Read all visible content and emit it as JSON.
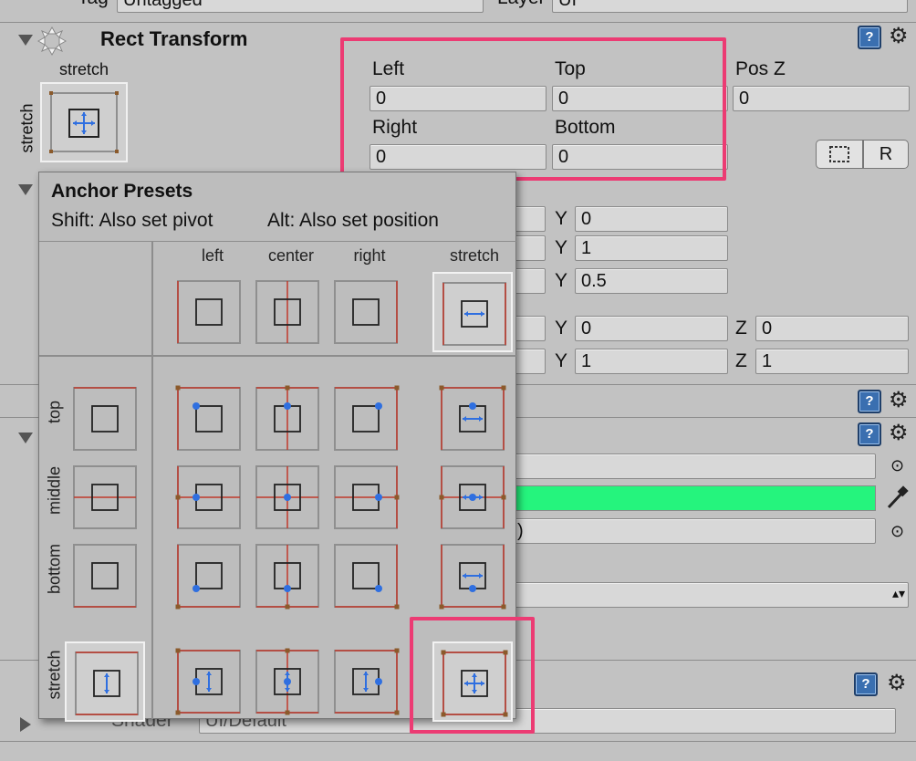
{
  "top_row": {
    "tag_label": "Tag",
    "tag_value": "Untagged",
    "layer_label": "Layer",
    "layer_value": "UI"
  },
  "rect_transform": {
    "title": "Rect Transform",
    "anchor_preview_top_label": "stretch",
    "anchor_preview_side_label": "stretch",
    "fields": [
      {
        "label": "Left",
        "value": "0"
      },
      {
        "label": "Top",
        "value": "0"
      },
      {
        "label": "Pos Z",
        "value": "0"
      },
      {
        "label": "Right",
        "value": "0"
      },
      {
        "label": "Bottom",
        "value": "0"
      }
    ],
    "blueprint_button_label": "",
    "raw_button_label": "R"
  },
  "hidden_rows": [
    {
      "y_label": "Y",
      "y_value": "0"
    },
    {
      "y_label": "Y",
      "y_value": "1"
    },
    {
      "y_label": "Y",
      "y_value": "0.5"
    },
    {
      "y_label": "Y",
      "y_value": "0",
      "z_label": "Z",
      "z_value": "0"
    },
    {
      "y_label": "Y",
      "y_value": "1",
      "z_label": "Z",
      "z_value": "1"
    }
  ],
  "image_component": {
    "color_hex": "#25f47d",
    "material_partial": ")",
    "shader_label": "Shader",
    "shader_value": "UI/Default"
  },
  "anchor_presets": {
    "title": "Anchor Presets",
    "shift_hint": "Shift: Also set pivot",
    "alt_hint": "Alt: Also set position",
    "columns": [
      "left",
      "center",
      "right",
      "stretch"
    ],
    "rows": [
      "top",
      "middle",
      "bottom",
      "stretch"
    ],
    "selected": "stretch-stretch"
  },
  "colors": {
    "highlight": "#ec3b73",
    "anchor_line": "#c0392b",
    "anchor_blue": "#2f6fe0",
    "panel_bg": "#c2c2c2"
  }
}
